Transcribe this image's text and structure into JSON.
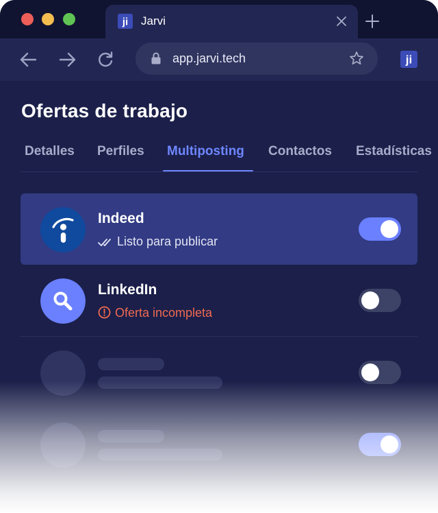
{
  "browser": {
    "tab_title": "Jarvi",
    "url": "app.jarvi.tech",
    "logo_text": "ji"
  },
  "page": {
    "title": "Ofertas de trabajo",
    "tabs": [
      {
        "label": "Detalles",
        "active": false
      },
      {
        "label": "Perfiles",
        "active": false
      },
      {
        "label": "Multiposting",
        "active": true
      },
      {
        "label": "Contactos",
        "active": false
      },
      {
        "label": "Estadísticas",
        "active": false
      }
    ]
  },
  "jobboards": [
    {
      "name": "Indeed",
      "status": "Listo para publicar",
      "status_type": "ready",
      "enabled": true,
      "icon": "indeed-icon"
    },
    {
      "name": "LinkedIn",
      "status": "Oferta incompleta",
      "status_type": "warning",
      "enabled": false,
      "icon": "search-icon"
    }
  ],
  "placeholder_rows": [
    {
      "enabled": false
    },
    {
      "enabled": true
    }
  ],
  "colors": {
    "background": "#1b1f49",
    "accent": "#6e86ff",
    "highlight_row": "#323b84",
    "warning": "#ef6a52",
    "indeed_blue": "#0f4a9e",
    "linkedin_avatar": "#6a80ff"
  }
}
